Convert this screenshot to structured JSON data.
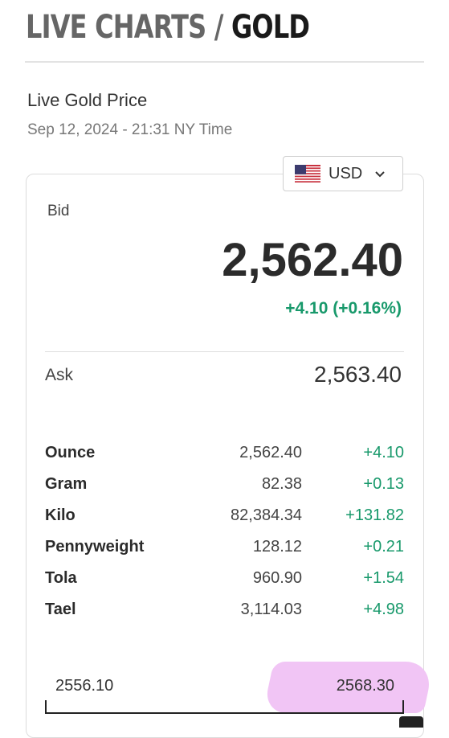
{
  "header": {
    "crumb": "LIVE CHARTS",
    "separator": "/",
    "current": "GOLD"
  },
  "page": {
    "title": "Live Gold Price",
    "timestamp": "Sep 12, 2024 - 21:31 NY Time"
  },
  "currency": {
    "selected": "USD",
    "flag_icon": "us-flag-icon"
  },
  "quote": {
    "bid_label": "Bid",
    "bid": "2,562.40",
    "change": "+4.10 (+0.16%)",
    "ask_label": "Ask",
    "ask": "2,563.40"
  },
  "units": [
    {
      "name": "Ounce",
      "price": "2,562.40",
      "change": "+4.10"
    },
    {
      "name": "Gram",
      "price": "82.38",
      "change": "+0.13"
    },
    {
      "name": "Kilo",
      "price": "82,384.34",
      "change": "+131.82"
    },
    {
      "name": "Pennyweight",
      "price": "128.12",
      "change": "+0.21"
    },
    {
      "name": "Tola",
      "price": "960.90",
      "change": "+1.54"
    },
    {
      "name": "Tael",
      "price": "3,114.03",
      "change": "+4.98"
    }
  ],
  "range": {
    "low": "2556.10",
    "high": "2568.30"
  },
  "colors": {
    "positive": "#18996b",
    "highlight": "#f1c5f5"
  }
}
